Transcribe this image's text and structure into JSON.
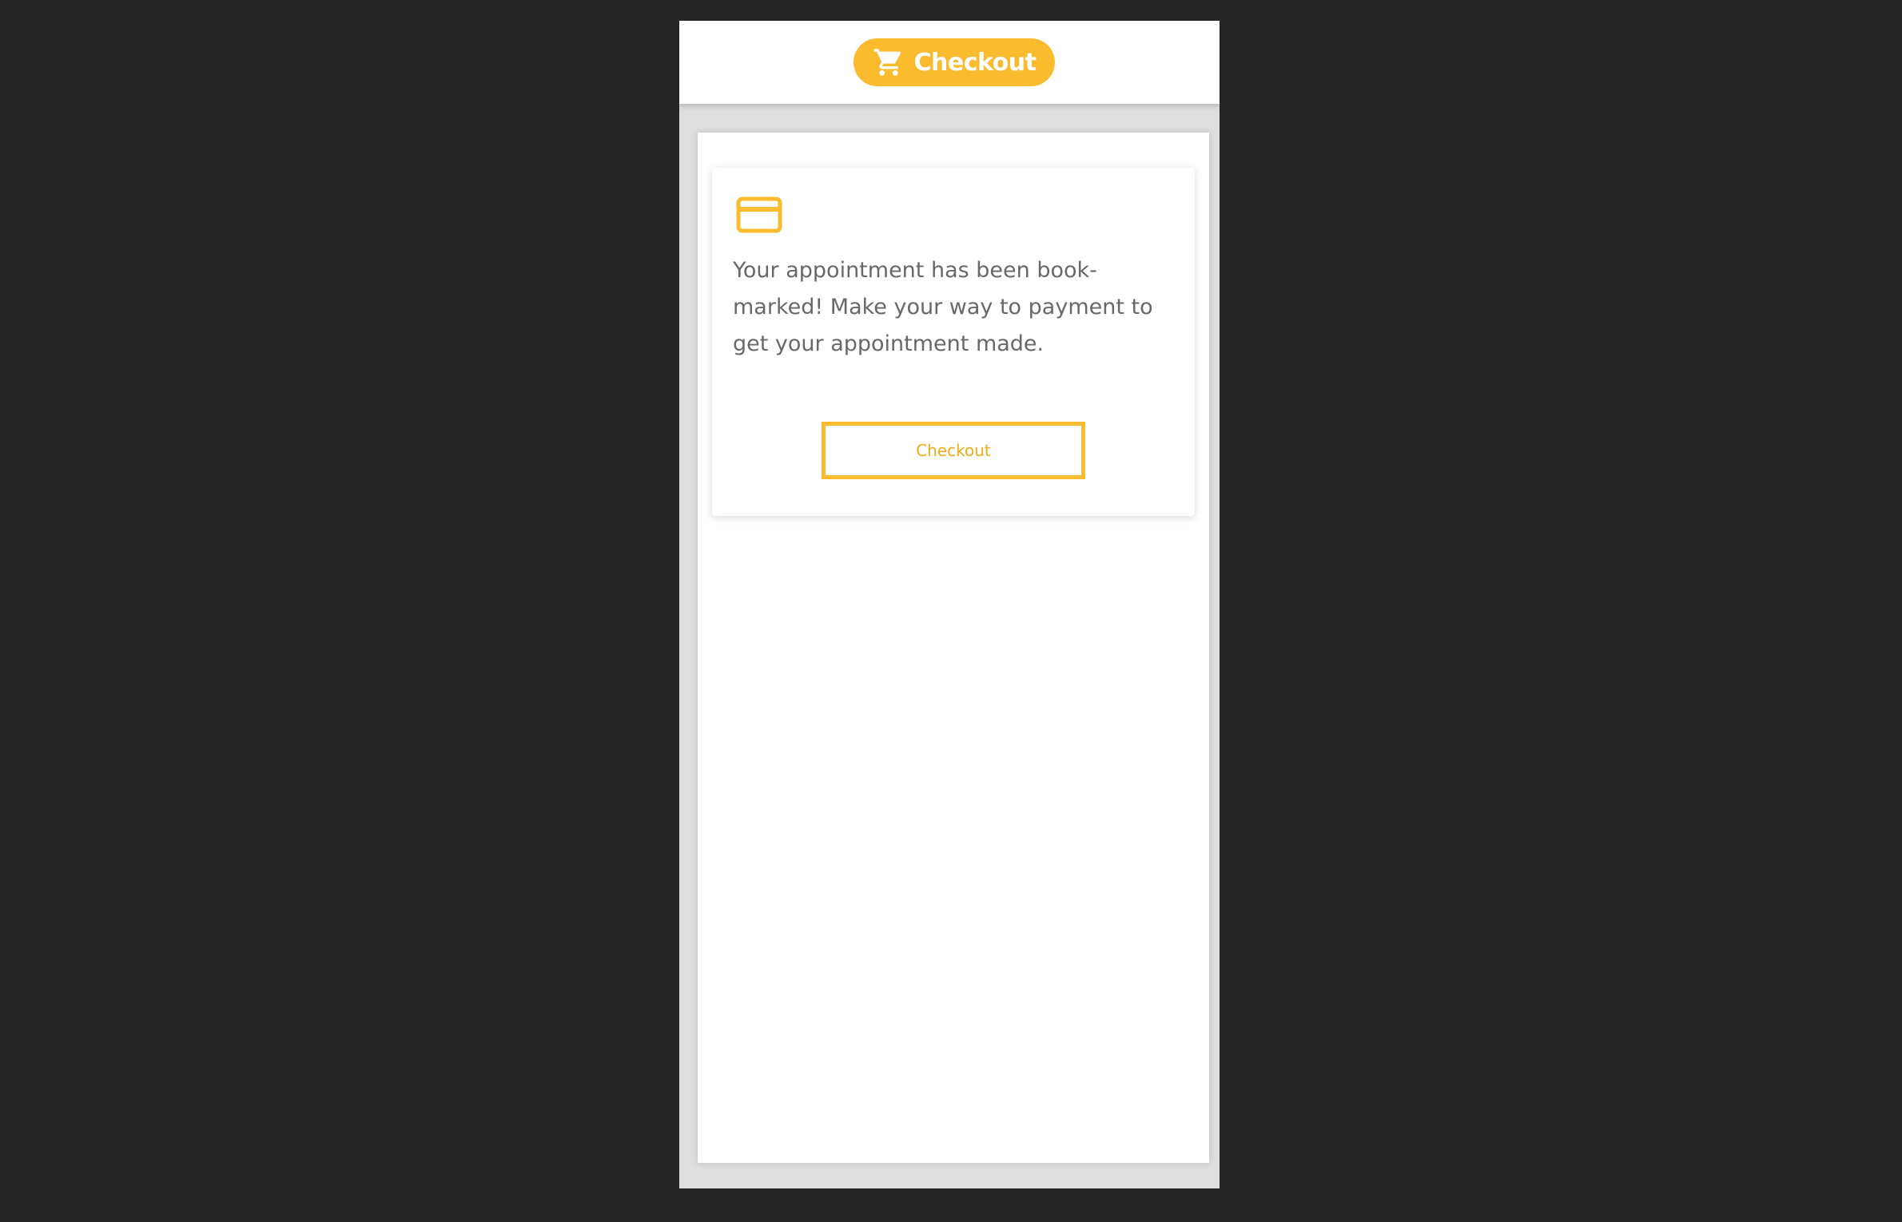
{
  "header": {
    "title": "Checkout",
    "icon": "shopping-cart-icon"
  },
  "card": {
    "icon": "credit-card-icon",
    "message": "Your appointment has been book-marked! Make your way to payment to get your appointment made.",
    "button_label": "Checkout"
  },
  "colors": {
    "accent": "#fbbb2e",
    "background": "#262626",
    "text": "#686868"
  }
}
